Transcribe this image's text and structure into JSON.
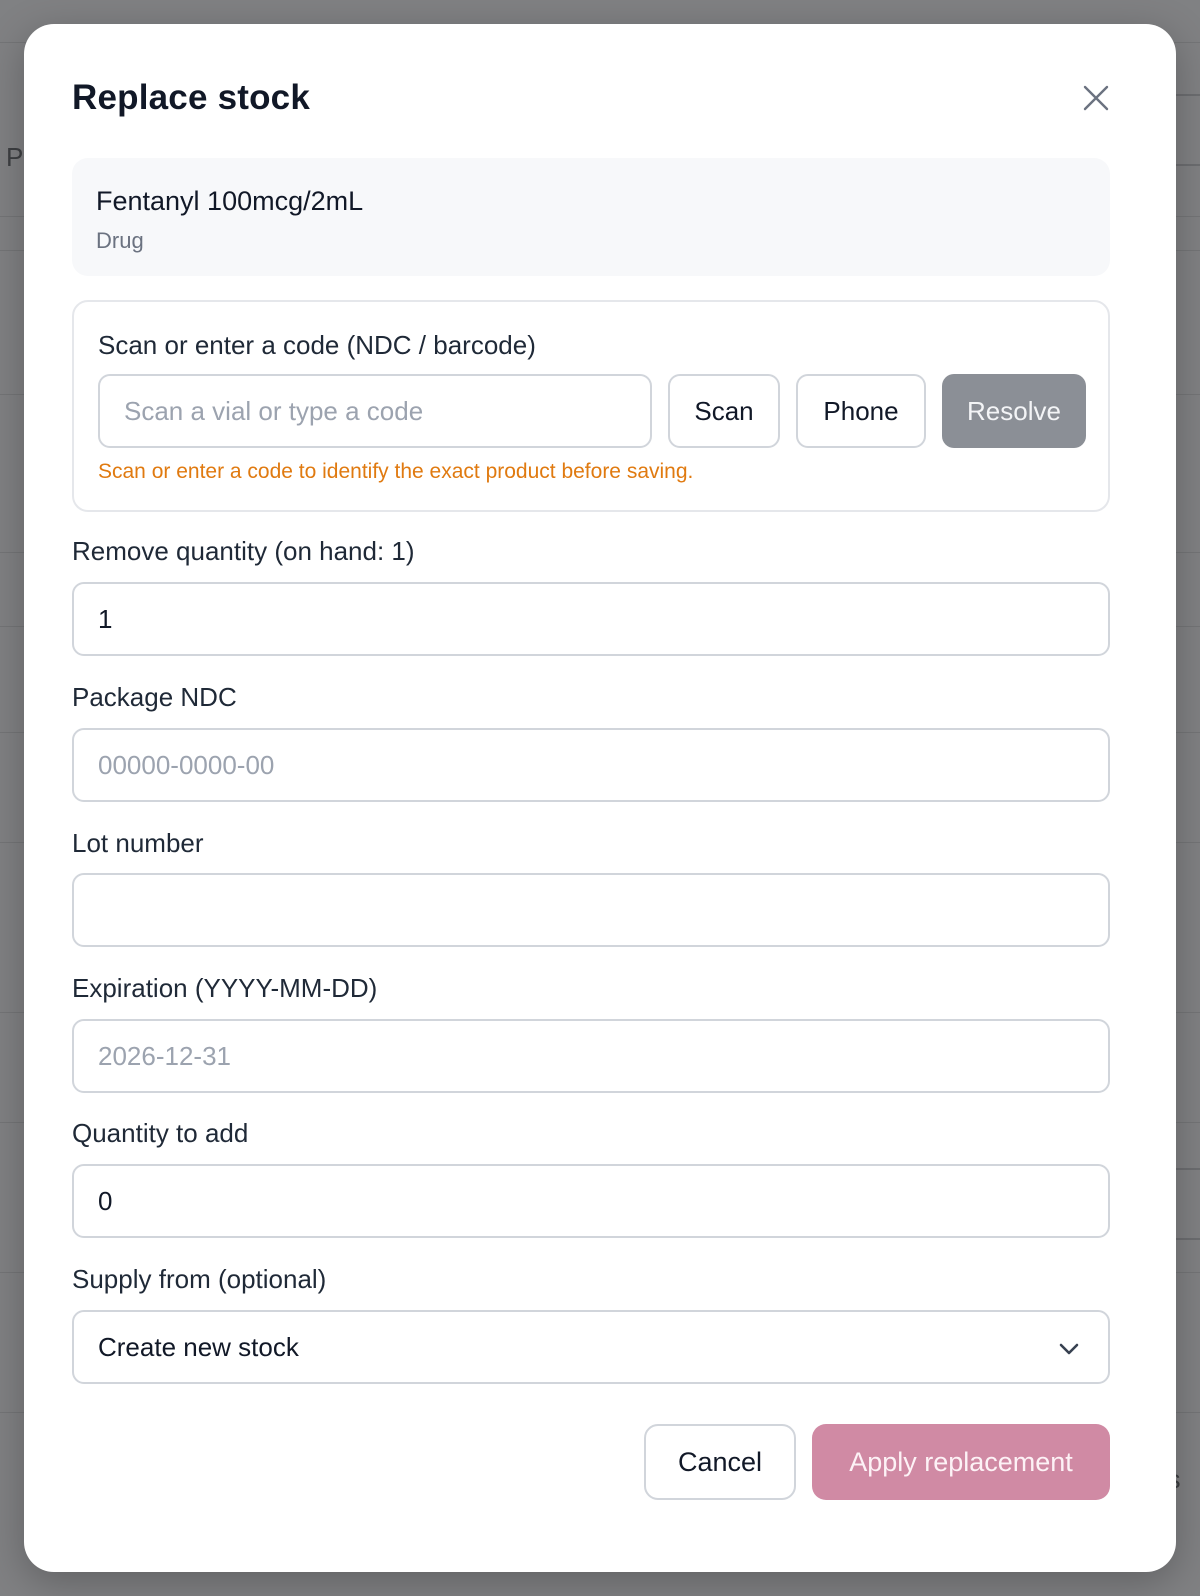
{
  "background": {
    "left_fragment": "P",
    "right_fragment": "lis"
  },
  "modal": {
    "title": "Replace stock",
    "close_icon": "close-icon"
  },
  "item": {
    "name": "Fentanyl 100mcg/2mL",
    "type": "Drug"
  },
  "scan": {
    "label": "Scan or enter a code (NDC / barcode)",
    "placeholder": "Scan a vial or type a code",
    "value": "",
    "scan_label": "Scan",
    "phone_label": "Phone",
    "resolve_label": "Resolve",
    "hint": "Scan or enter a code to identify the exact product before saving."
  },
  "fields": {
    "remove_quantity": {
      "label": "Remove quantity (on hand: 1)",
      "value": "1"
    },
    "package_ndc": {
      "label": "Package NDC",
      "placeholder": "00000-0000-00",
      "value": ""
    },
    "lot_number": {
      "label": "Lot number",
      "value": ""
    },
    "expiration": {
      "label": "Expiration (YYYY-MM-DD)",
      "placeholder": "2026-12-31",
      "value": ""
    },
    "quantity_to_add": {
      "label": "Quantity to add",
      "value": "0"
    },
    "supply_from": {
      "label": "Supply from (optional)",
      "selected": "Create new stock",
      "icon": "chevron-down-icon"
    }
  },
  "footer": {
    "cancel_label": "Cancel",
    "apply_label": "Apply replacement"
  },
  "colors": {
    "hint": "#e07a10",
    "resolve_bg": "#8b8f96",
    "apply_bg": "#d08aa4",
    "overlay": "#808183"
  }
}
